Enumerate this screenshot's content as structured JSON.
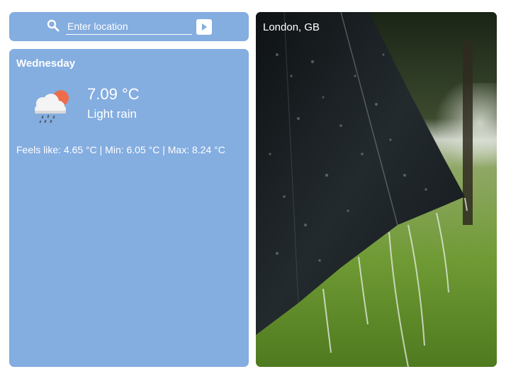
{
  "search": {
    "placeholder": "Enter location"
  },
  "weather": {
    "day": "Wednesday",
    "temperature": "7.09 °C",
    "description": "Light rain",
    "details": "Feels like: 4.65 °C | Min: 6.05 °C | Max: 8.24 °C",
    "icon": "cloud-rain-sun-icon"
  },
  "photo": {
    "location": "London, GB",
    "subject": "umbrella-in-rain"
  },
  "colors": {
    "card_background": "#84ade0",
    "text": "#ffffff",
    "sun": "#ef6c4a"
  }
}
